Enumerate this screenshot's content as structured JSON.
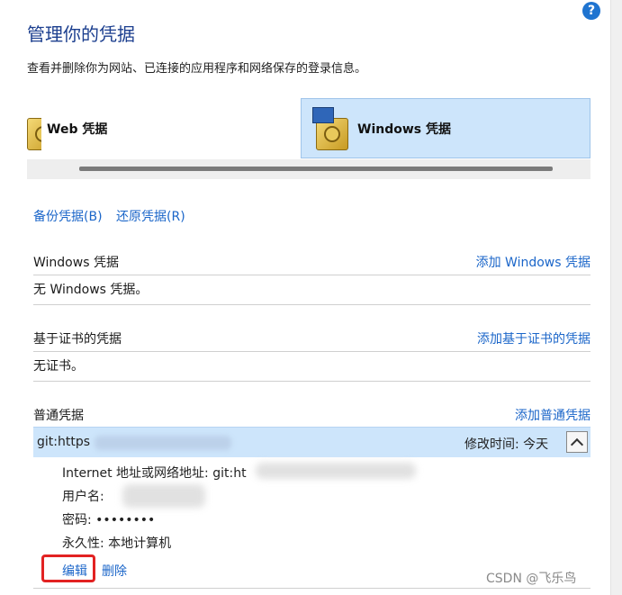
{
  "header": {
    "title": "管理你的凭据",
    "description": "查看并删除你为网站、已连接的应用程序和网络保存的登录信息。",
    "help_glyph": "?"
  },
  "tabs": [
    {
      "label": "Web 凭据",
      "icon": "vault-icon",
      "selected": false
    },
    {
      "label": "Windows 凭据",
      "icon": "vault-monitor-icon",
      "selected": true
    }
  ],
  "actions": {
    "backup_label": "备份凭据(B)",
    "restore_label": "还原凭据(R)"
  },
  "sections": {
    "windows": {
      "title": "Windows 凭据",
      "add_label": "添加 Windows 凭据",
      "empty_text": "无 Windows 凭据。"
    },
    "certificate": {
      "title": "基于证书的凭据",
      "add_label": "添加基于证书的凭据",
      "empty_text": "无证书。"
    },
    "generic": {
      "title": "普通凭据",
      "add_label": "添加普通凭据"
    }
  },
  "credential": {
    "name": "git:https",
    "modified_label": "修改时间:",
    "modified_value": "今天",
    "address_label": "Internet 地址或网络地址:",
    "address_value": "git:ht",
    "username_label": "用户名:",
    "password_label": "密码:",
    "password_value": "••••••••",
    "persistence_label": "永久性:",
    "persistence_value": "本地计算机",
    "edit_label": "编辑",
    "delete_label": "删除"
  },
  "watermark": "CSDN @飞乐鸟",
  "colors": {
    "accent": "#1b66c9",
    "selected_bg": "#cde5fb",
    "title": "#1c3f8f",
    "highlight": "#e22222"
  }
}
